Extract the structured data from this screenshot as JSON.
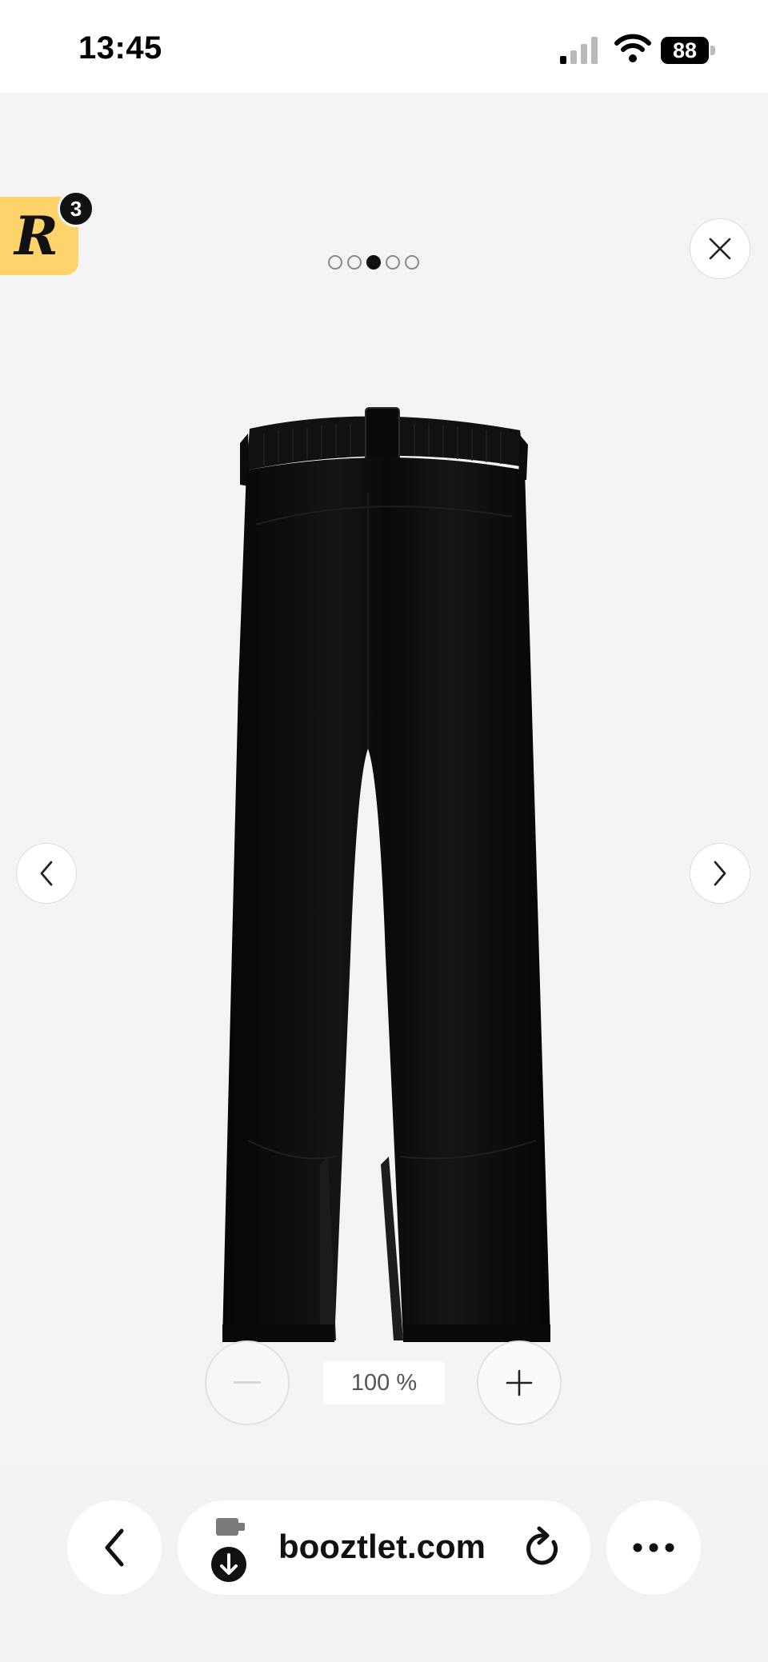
{
  "status_bar": {
    "time": "13:45",
    "battery": "88"
  },
  "viewer": {
    "rewards_badge": {
      "letter": "R",
      "count": "3"
    },
    "pagination": {
      "total": 5,
      "active_index": 2
    },
    "zoom": {
      "level": "100 %"
    },
    "icons": {
      "close": "close-icon",
      "prev": "chevron-left-icon",
      "next": "chevron-right-icon",
      "zoom_out": "minus-icon",
      "zoom_in": "plus-icon"
    }
  },
  "browser": {
    "url": "booztlet.com",
    "icons": {
      "back": "chevron-left-icon",
      "extension": "extension-download-icon",
      "reload": "reload-icon",
      "more": "more-icon"
    }
  },
  "colors": {
    "badge": "#ffd36b",
    "background": "#f4f4f4",
    "product": "#0d0d0d"
  }
}
